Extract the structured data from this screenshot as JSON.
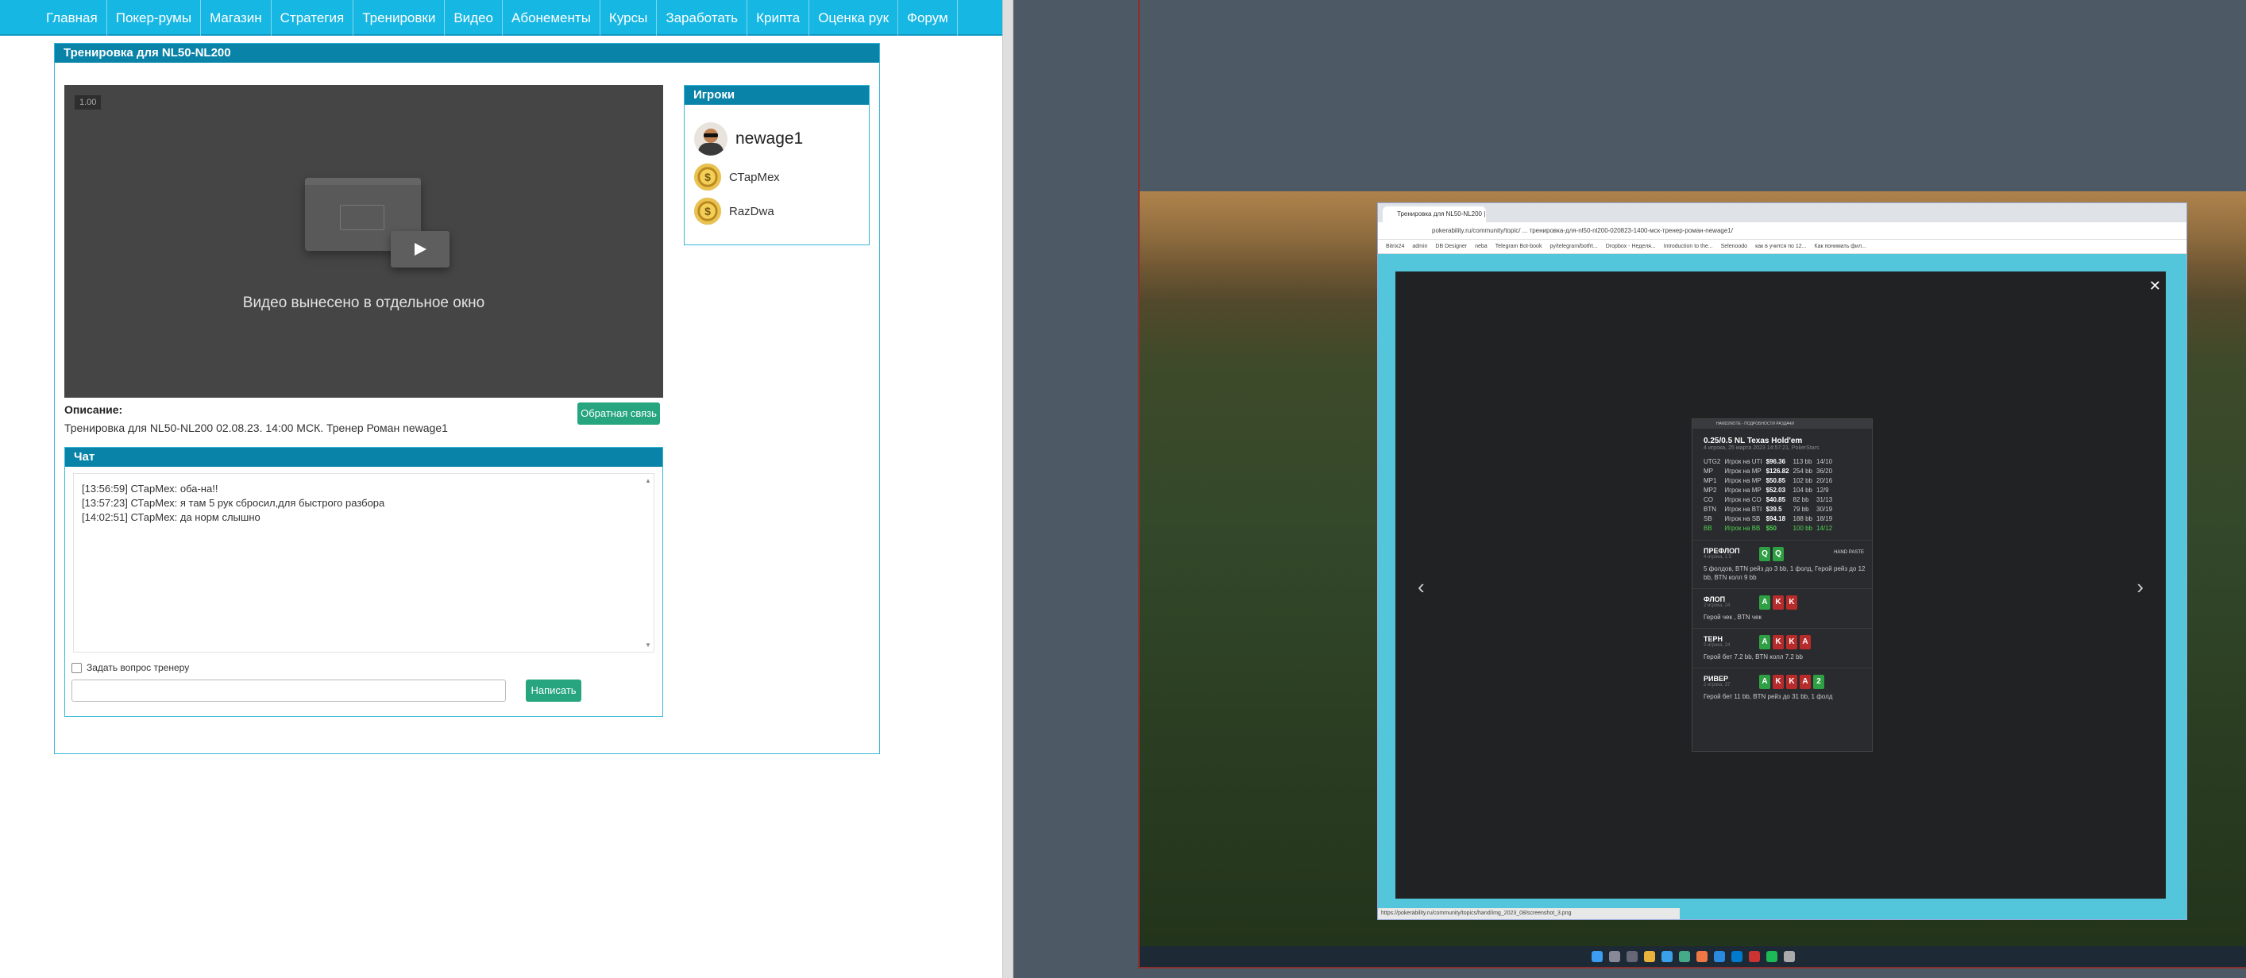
{
  "nav": [
    "Главная",
    "Покер-румы",
    "Магазин",
    "Стратегия",
    "Тренировки",
    "Видео",
    "Абонементы",
    "Курсы",
    "Заработать",
    "Крипта",
    "Оценка рук",
    "Форум"
  ],
  "training": {
    "title": "Тренировка для NL50-NL200",
    "video_badge": "1.00",
    "video_message": "Видео вынесено в отдельное окно",
    "description_label": "Описание:",
    "description": "Тренировка для NL50-NL200 02.08.23. 14:00 МСК. Тренер Роман newage1",
    "feedback_button": "Обратная связь"
  },
  "chat": {
    "title": "Чат",
    "messages": [
      "[13:56:59] СТарМех: оба-на!!",
      "[13:57:23] СТарМех: я там 5 рук сбросил,для быстрого разбора",
      "[14:02:51] СТарМех: да норм слышно"
    ],
    "ask_coach": "Задать вопрос тренеру",
    "send_button": "Написать",
    "input_value": ""
  },
  "players": {
    "title": "Игроки",
    "list": [
      "newage1",
      "СТарМех",
      "RazDwa"
    ]
  },
  "browser": {
    "tab_title": "Тренировка для NL50-NL200 | ...",
    "address": "pokerability.ru/community/topic/ ... тренировка-для-nl50-nl200-020823-1400-мск-тренер-роман-newage1/",
    "bookmarks": [
      "Bitrix24",
      "admin",
      "DB Designer",
      "neba",
      "Telegram Bot-book",
      "py/telegram/botfrt...",
      "Dropbox - Неделя...",
      "Introduction to the...",
      "Selenoodo",
      "как в учится по 12...",
      "Как понимать фил..."
    ],
    "status_url": "https://pokerability.ru/community/topics/hand/img_2023_08/screenshot_3.png"
  },
  "hand": {
    "bar": "HAND2NOTE - ПОДРОБНОСТИ РАЗДАЧИ",
    "title": "0.25/0.5 NL Texas Hold'em",
    "subtitle": "4 игрока, 25 марта 2023 14:57:21, PokerStars",
    "seats": [
      {
        "pos": "UTG2",
        "name": "Игрок на UTI",
        "stack": "$96.36",
        "bb": "113 bb",
        "hands": "14/10"
      },
      {
        "pos": "MP",
        "name": "Игрок на MP",
        "stack": "$126.82",
        "bb": "254 bb",
        "hands": "36/20"
      },
      {
        "pos": "MP1",
        "name": "Игрок на MP",
        "stack": "$50.85",
        "bb": "102 bb",
        "hands": "20/16"
      },
      {
        "pos": "MP2",
        "name": "Игрок на MP",
        "stack": "$52.03",
        "bb": "104 bb",
        "hands": "12/9"
      },
      {
        "pos": "CO",
        "name": "Игрок на CO",
        "stack": "$40.85",
        "bb": "82 bb",
        "hands": "31/13"
      },
      {
        "pos": "BTN",
        "name": "Игрок на BTI",
        "stack": "$39.5",
        "bb": "79 bb",
        "hands": "30/19"
      },
      {
        "pos": "SB",
        "name": "Игрок на SB",
        "stack": "$94.18",
        "bb": "188 bb",
        "hands": "18/19"
      },
      {
        "pos": "BB",
        "name": "Игрок на BB",
        "stack": "$50",
        "bb": "100 bb",
        "hands": "14/12"
      }
    ],
    "hand_paste": "HAND PASTE",
    "streets": [
      {
        "name": "ПРЕФЛОП",
        "sub": "4 игрока, 1.5",
        "cards": [
          [
            "Q",
            "g"
          ],
          [
            "Q",
            "g"
          ]
        ],
        "action": "5 фолдов, BTN рейз до 3 bb, 1 фолд, Герой рейз до 12 bb, BTN колл 9 bb"
      },
      {
        "name": "ФЛОП",
        "sub": "2 игрока, 24",
        "cards": [
          [
            "A",
            "g"
          ],
          [
            "K",
            "r"
          ],
          [
            "K",
            "r"
          ]
        ],
        "action": "Герой чек , BTN чек"
      },
      {
        "name": "ТЕРН",
        "sub": "2 игрока, 24",
        "cards": [
          [
            "A",
            "g"
          ],
          [
            "K",
            "r"
          ],
          [
            "K",
            "r"
          ],
          [
            "A",
            "r"
          ]
        ],
        "action": "Герой бет 7.2 bb, BTN колл 7.2 bb"
      },
      {
        "name": "РИВЕР",
        "sub": "2 игрока, 37",
        "cards": [
          [
            "A",
            "g"
          ],
          [
            "K",
            "r"
          ],
          [
            "K",
            "r"
          ],
          [
            "A",
            "r"
          ],
          [
            "2",
            "g"
          ]
        ],
        "action": "Герой бет 11 bb, BTN рейз до 31 bb, 1 фолд"
      }
    ]
  }
}
